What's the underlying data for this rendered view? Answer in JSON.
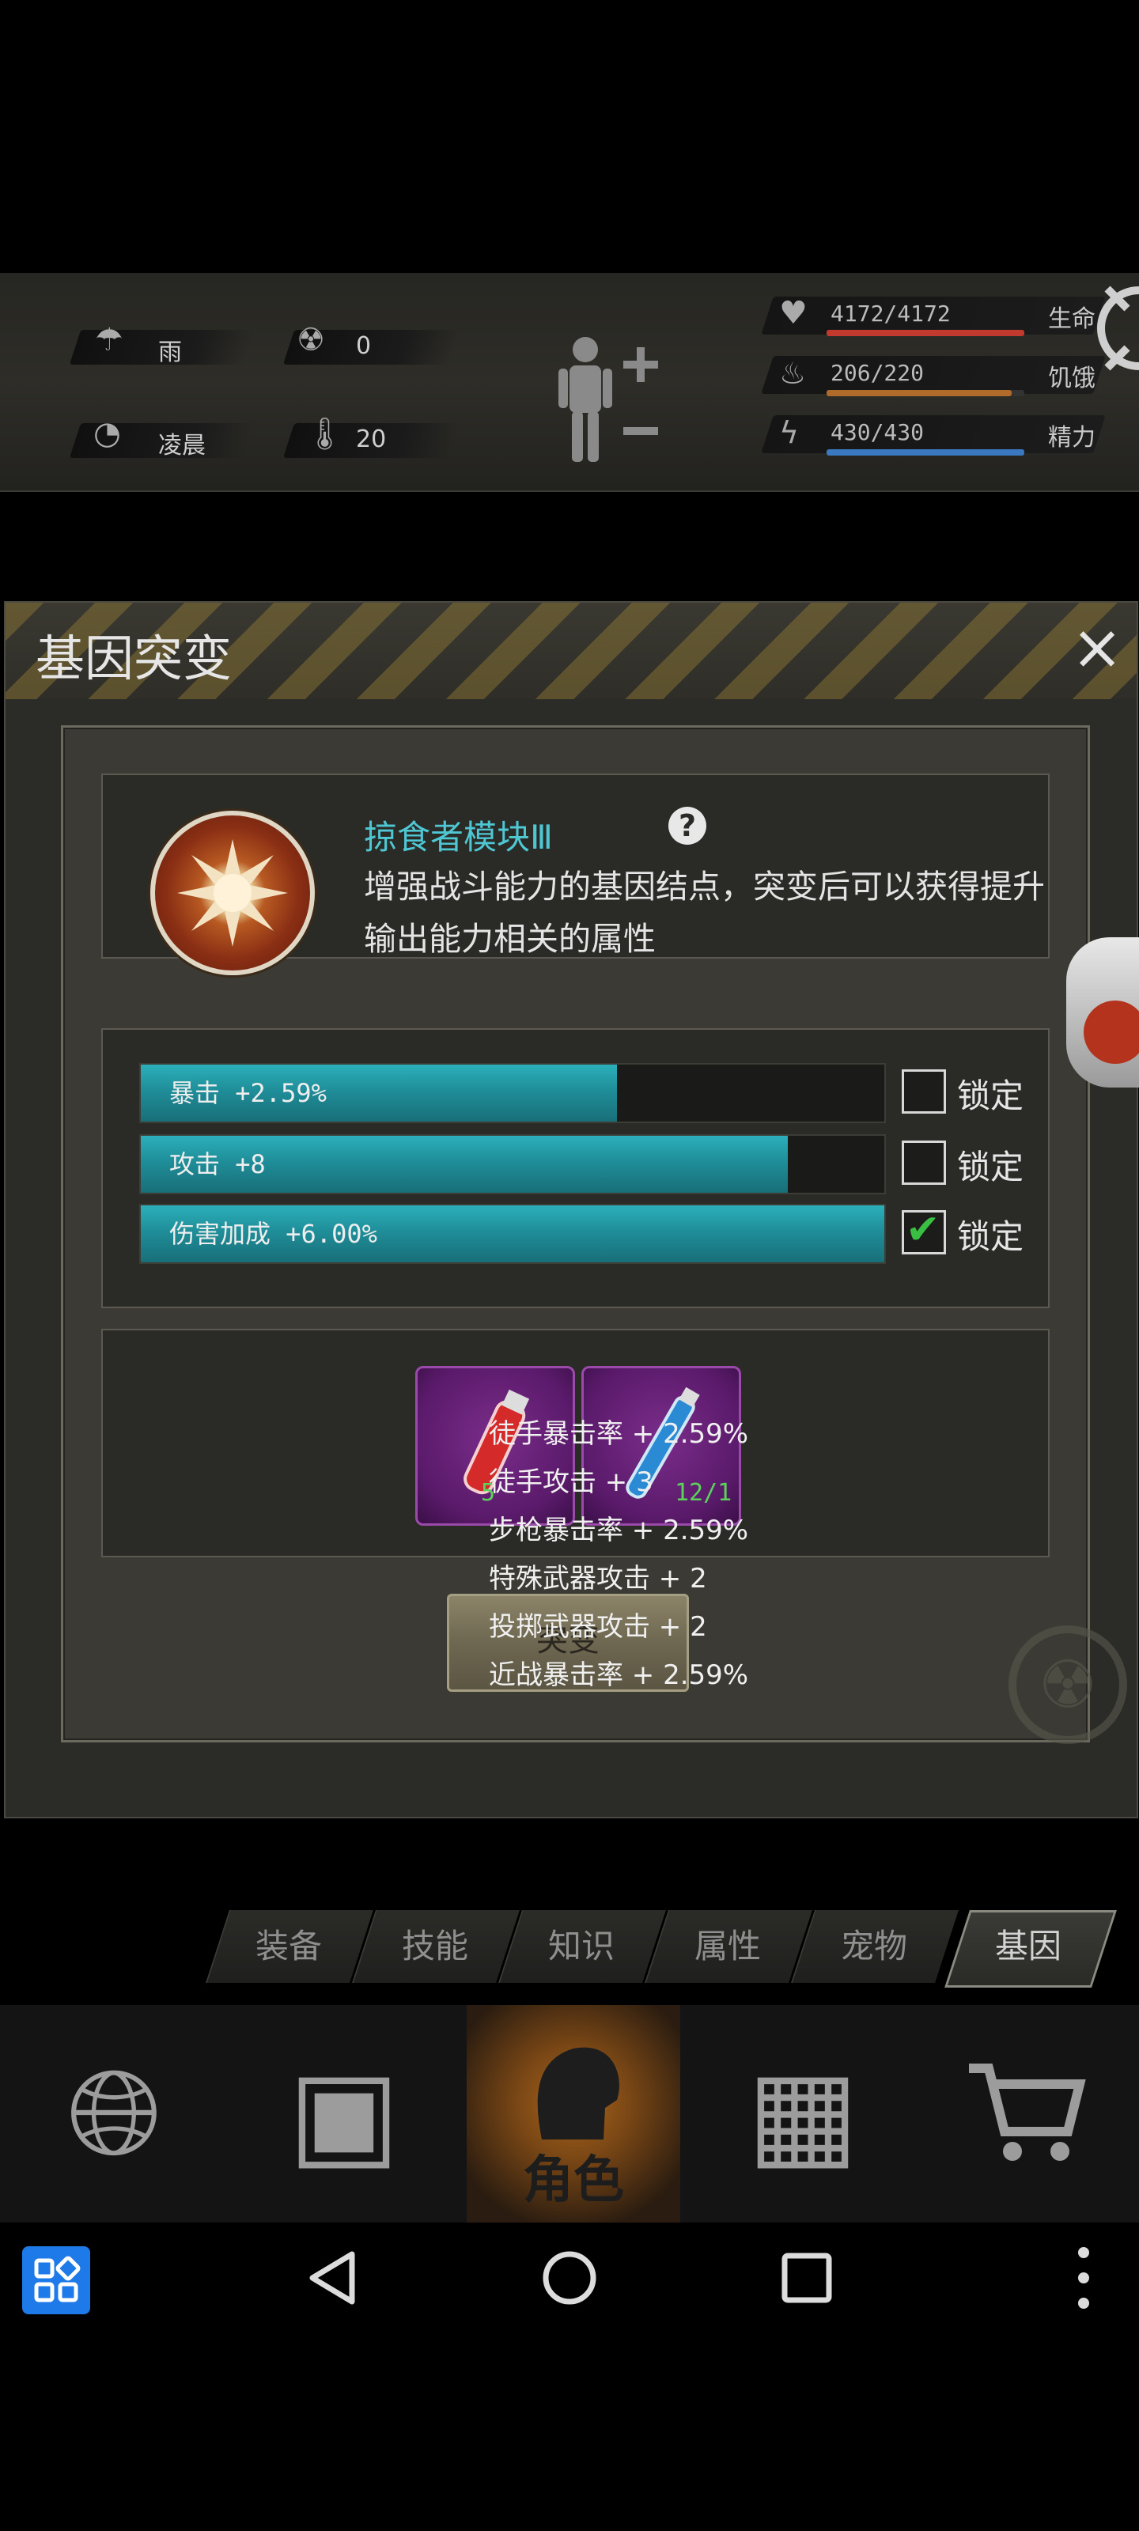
{
  "status": {
    "weather": "雨",
    "radiation": "0",
    "time_of_day": "凌晨",
    "temperature": "20",
    "health": {
      "value": "4172/4172",
      "label": "生命",
      "fill": 1.0,
      "color": "#c23a2e"
    },
    "hunger": {
      "value": "206/220",
      "label": "饥饿",
      "fill": 0.936,
      "color": "#b06a2a"
    },
    "energy": {
      "value": "430/430",
      "label": "精力",
      "fill": 1.0,
      "color": "#3a78c0"
    }
  },
  "dialog": {
    "title": "基因突变",
    "close": "×",
    "gene": {
      "name": "掠食者模块Ⅲ",
      "help": "?",
      "description": "增强战斗能力的基因结点，突变后可以获得提升输出能力相关的属性"
    },
    "attributes": [
      {
        "text": "暴击 +2.59%",
        "fill": 0.64,
        "lock_label": "锁定",
        "locked": false
      },
      {
        "text": "攻击 +8",
        "fill": 0.87,
        "lock_label": "锁定",
        "locked": false
      },
      {
        "text": "伤害加成 +6.00%",
        "fill": 1.0,
        "lock_label": "锁定",
        "locked": true
      }
    ],
    "items": [
      {
        "name": "red-vial",
        "count": "5",
        "color": "#d42a2a"
      },
      {
        "name": "blue-vial",
        "count": "12/1",
        "color": "#2a8ad4"
      }
    ],
    "mutate_button": "突变",
    "tooltip": [
      "徒手暴击率 + 2.59%",
      "徒手攻击 + 3",
      "步枪暴击率 + 2.59%",
      "特殊武器攻击 + 2",
      "投掷武器攻击 + 2",
      "近战暴击率 + 2.59%"
    ]
  },
  "tabs": [
    {
      "label": "装备",
      "active": false
    },
    {
      "label": "技能",
      "active": false
    },
    {
      "label": "知识",
      "active": false
    },
    {
      "label": "属性",
      "active": false
    },
    {
      "label": "宠物",
      "active": false
    },
    {
      "label": "基因",
      "active": true
    }
  ],
  "bottom_nav": {
    "role_label": "角色"
  }
}
